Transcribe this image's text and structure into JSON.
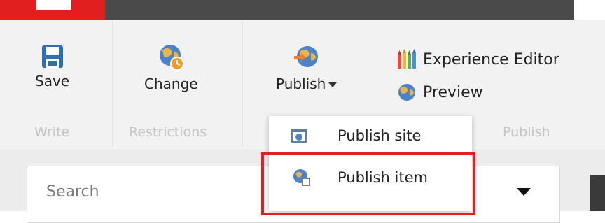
{
  "ribbon": {
    "write": {
      "group_label": "Write",
      "save_label": "Save"
    },
    "restrictions": {
      "group_label": "Restrictions",
      "change_label": "Change"
    },
    "publish": {
      "group_label": "Publish",
      "publish_label": "Publish",
      "experience_editor_label": "Experience Editor",
      "preview_label": "Preview"
    }
  },
  "publish_menu": {
    "items": [
      {
        "label": "Publish site",
        "icon": "publish-site-icon"
      },
      {
        "label": "Publish item",
        "icon": "publish-item-icon"
      }
    ],
    "highlighted_item": "Publish item"
  },
  "search": {
    "placeholder": "Search"
  },
  "colors": {
    "accent_red": "#e11f1f",
    "topbar": "#4a4a4a",
    "ribbon_bg": "#f2f2f2"
  }
}
